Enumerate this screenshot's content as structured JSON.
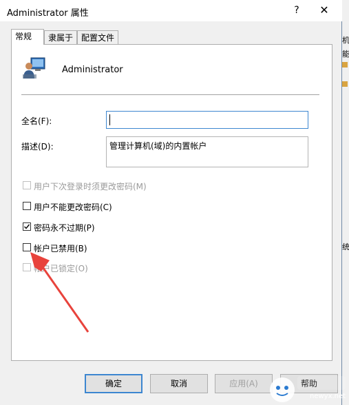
{
  "window": {
    "title": "Administrator 属性",
    "help_glyph": "?",
    "close_glyph": "✕"
  },
  "tabs": [
    {
      "label": "常规",
      "active": true
    },
    {
      "label": "隶属于",
      "active": false
    },
    {
      "label": "配置文件",
      "active": false
    }
  ],
  "user": {
    "name": "Administrator",
    "icon": "user-icon"
  },
  "fields": {
    "fullname_label": "全名(F):",
    "fullname_value": "",
    "description_label": "描述(D):",
    "description_value": "管理计算机(域)的内置帐户"
  },
  "checkboxes": [
    {
      "label": "用户下次登录时须更改密码(M)",
      "checked": false,
      "enabled": false
    },
    {
      "label": "用户不能更改密码(C)",
      "checked": false,
      "enabled": true
    },
    {
      "label": "密码永不过期(P)",
      "checked": true,
      "enabled": true
    },
    {
      "label": "帐户已禁用(B)",
      "checked": false,
      "enabled": true
    },
    {
      "label": "帐户已锁定(O)",
      "checked": false,
      "enabled": false
    }
  ],
  "buttons": {
    "ok": "确定",
    "cancel": "取消",
    "apply": "应用(A)",
    "help": "帮助"
  },
  "background_window_text": [
    "机",
    "能",
    "统"
  ],
  "watermark": {
    "text": "newyx.net"
  },
  "colors": {
    "arrow": "#e8433c",
    "accent": "#3c86d0",
    "desktop": "#1e6fb0"
  }
}
